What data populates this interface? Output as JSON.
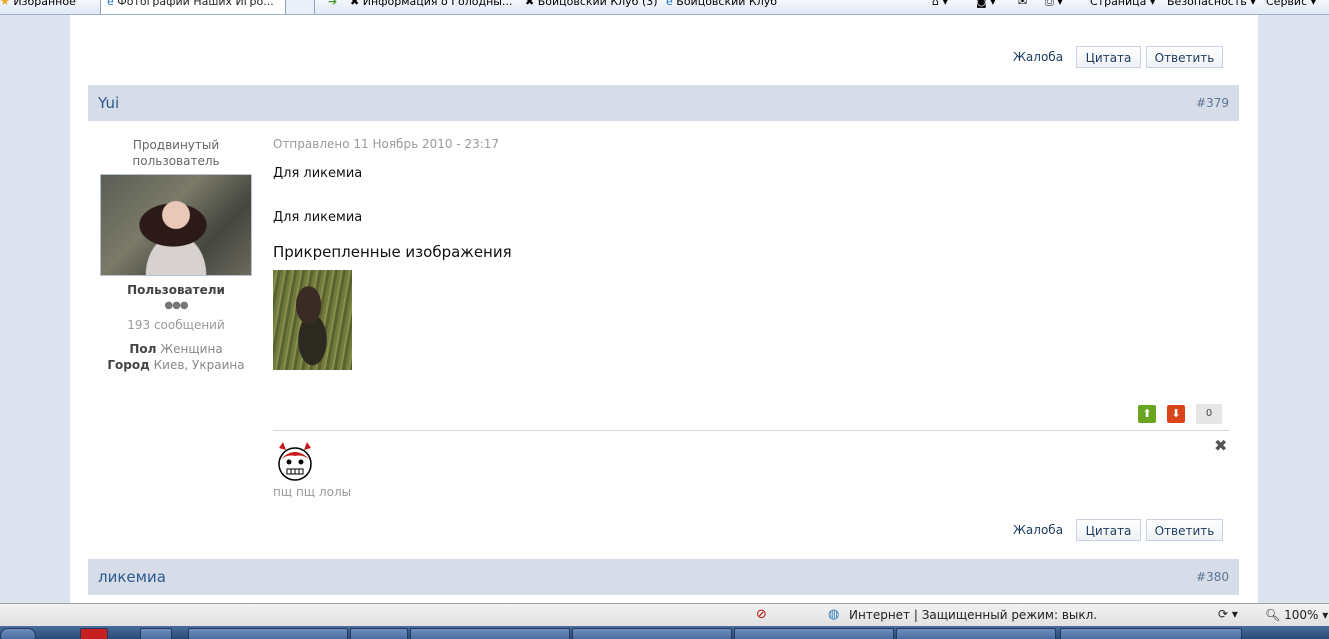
{
  "browser": {
    "favorites_label": "Избранное",
    "tabs": [
      {
        "label": "Фотографии Наших Игро..."
      }
    ],
    "links": [
      {
        "label": "Информация о Голодны..."
      },
      {
        "label": "Бойцовский Клуб (3)"
      },
      {
        "label": "Бойцовский Клуб"
      }
    ],
    "tools": {
      "page": "Страница ▾",
      "security": "Безопасность ▾",
      "service": "Сервис ▾"
    }
  },
  "top_actions": {
    "complaint": "Жалоба",
    "quote": "Цитата",
    "reply": "Ответить"
  },
  "post": {
    "author": "Yui",
    "number": "#379",
    "rank": "Продвинутый пользователь",
    "group": "Пользователи",
    "pips": "●●●",
    "posts_count": "193 сообщений",
    "gender_label": "Пол",
    "gender_value": "Женщина",
    "city_label": "Город",
    "city_value": "Киев, Украина",
    "date": "Отправлено 11 Ноябрь 2010 - 23:17",
    "text1": "Для ликемиа",
    "text2": "Для ликемиа",
    "attachments_title": "Прикрепленные изображения",
    "rating_value": "0",
    "signature": "пщ пщ лолы",
    "actions": {
      "complaint": "Жалоба",
      "quote": "Цитата",
      "reply": "Ответить"
    }
  },
  "next_post": {
    "author": "ликемиа",
    "number": "#380"
  },
  "statusbar": {
    "zone": "Интернет | Защищенный режим: выкл.",
    "zoom": "100%"
  },
  "colors": {
    "vote_up": "#6aa51f",
    "vote_down": "#d9441a",
    "header_bg": "#d7dde8",
    "author_link": "#2c5a8a"
  }
}
